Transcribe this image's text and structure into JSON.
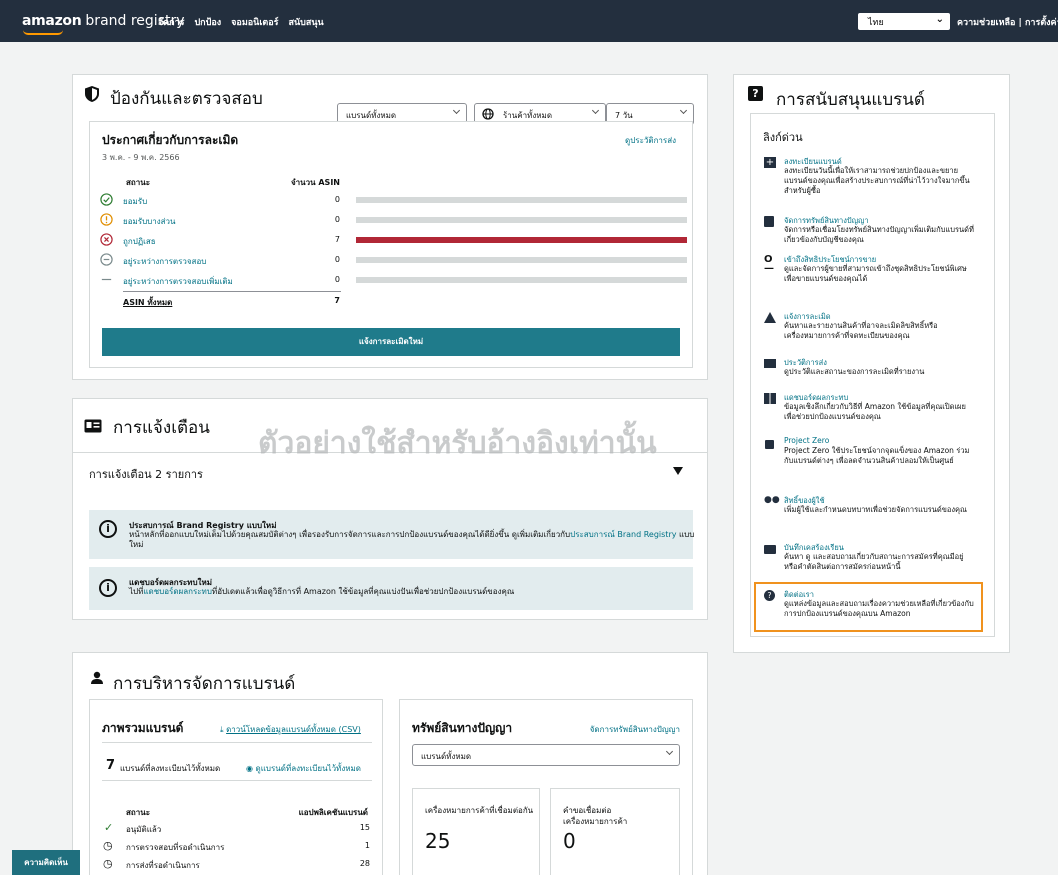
{
  "topbar": {
    "logo_brand": "amazon",
    "logo_product": "brand registry",
    "nav": [
      "จัดการ",
      "ปกป้อง",
      "จอมอนิเตอร์",
      "สนับสนุน"
    ],
    "language": "ไทย",
    "links": "ความช่วยเหลือ | การตั้งค่า"
  },
  "protect": {
    "title": "ป้องกันและตรวจสอบ",
    "filter_brand": "แบรนด์ทั้งหมด",
    "filter_store": "ร้านค้าทั้งหมด",
    "filter_days": "7 วัน",
    "report_title": "ประกาศเกี่ยวกับการละเมิด",
    "history_link": "ดูประวัติการส่ง",
    "date_range": "3 พ.ค. - 9 พ.ค. 2566",
    "col_status": "สถานะ",
    "col_count": "จำนวน ASIN",
    "rows": [
      {
        "label": "ยอมรับ",
        "count": "0",
        "fraction": 0
      },
      {
        "label": "ยอมรับบางส่วน",
        "count": "0",
        "fraction": 0
      },
      {
        "label": "ถูกปฏิเสธ",
        "count": "7",
        "fraction": 1
      },
      {
        "label": "อยู่ระหว่างการตรวจสอบ",
        "count": "0",
        "fraction": 0
      },
      {
        "label": "อยู่ระหว่างการตรวจสอบเพิ่มเติม",
        "count": "0",
        "fraction": 0
      }
    ],
    "total_label": "ASIN ทั้งหมด",
    "total_count": "7",
    "report_button": "แจ้งการละเมิดใหม่"
  },
  "alerts": {
    "title": "การแจ้งเตือน",
    "count_text": "การแจ้งเตือน 2 รายการ",
    "items": [
      {
        "title": "ประสบการณ์ Brand Registry แบบใหม่",
        "text": "หน้าหลักที่ออกแบบใหม่เต็มไปด้วยคุณสมบัติต่างๆ เพื่อรองรับการจัดการและการปกป้องแบรนด์ของคุณได้ดียิ่งขึ้น ดูเพิ่มเติมเกี่ยวกับ",
        "link": "ประสบการณ์ Brand Registry",
        "suffix": "แบบใหม่"
      },
      {
        "title": "แดชบอร์ดผลกระทบใหม่",
        "prefix": "ไปที่",
        "link": "แดชบอร์ดผลกระทบ",
        "text": "ที่อัปเดตแล้วเพื่อดูวิธีการที่ Amazon ใช้ข้อมูลที่คุณแบ่งปันเพื่อช่วยปกป้องแบรนด์ของคุณ"
      }
    ]
  },
  "manage": {
    "title": "การบริหารจัดการแบรนด์",
    "overview_title": "ภาพรวมแบรนด์",
    "download_link": "ดาวน์โหลดข้อมูลแบรนด์ทั้งหมด (CSV)",
    "registered_count": "7",
    "registered_text": "แบรนด์ที่ลงทะเบียนไว้ทั้งหมด",
    "view_link": "ดูแบรนด์ที่ลงทะเบียนไว้ทั้งหมด",
    "col_status": "สถานะ",
    "col_apps": "แอปพลิเคชันแบรนด์",
    "rows": [
      {
        "label": "อนุมัติแล้ว",
        "count": "15"
      },
      {
        "label": "การตรวจสอบที่รอดำเนินการ",
        "count": "1"
      },
      {
        "label": "การส่งที่รอดำเนินการ",
        "count": "28"
      }
    ],
    "ip_title": "ทรัพย์สินทางปัญญา",
    "ip_link": "จัดการทรัพย์สินทางปัญญา",
    "ip_filter": "แบรนด์ทั้งหมด",
    "tm_label": "เครื่องหมายการค้าที่เชื่อมต่อกัน",
    "tm_value": "25",
    "req_label": "คำขอเชื่อมต่อเครื่องหมายการค้า",
    "req_value": "0"
  },
  "support": {
    "title": "การสนับสนุนแบรนด์",
    "quick_links": "ลิงก์ด่วน",
    "items": [
      {
        "icon": "plus-square-icon",
        "title": "ลงทะเบียนแบรนด์",
        "desc": "ลงทะเบียนวันนี้เพื่อให้เราสามารถช่วยปกป้องและขยายแบรนด์ของคุณเพื่อสร้างประสบการณ์ที่น่าไว้วางใจมากขึ้นสำหรับผู้ซื้อ"
      },
      {
        "icon": "book-icon",
        "title": "จัดการทรัพย์สินทางปัญญา",
        "desc": "จัดการหรือเชื่อมโยงทรัพย์สินทางปัญญาเพิ่มเติมกับแบรนด์ที่เกี่ยวข้องกับบัญชีของคุณ"
      },
      {
        "icon": "key-icon",
        "title": "เข้าถึงสิทธิประโยชน์การขาย",
        "desc": "ดูและจัดการผู้ขายที่สามารถเข้าถึงชุดสิทธิประโยชน์พิเศษเพื่อขายแบรนด์ของคุณได้"
      },
      {
        "icon": "warning-icon",
        "title": "แจ้งการละเมิด",
        "desc": "ค้นหาและรายงานสินค้าที่อาจละเมิดลิขสิทธิ์หรือเครื่องหมายการค้าที่จดทะเบียนของคุณ"
      },
      {
        "icon": "folder-icon",
        "title": "ประวัติการส่ง",
        "desc": "ดูประวัติและสถานะของการละเมิดที่รายงาน"
      },
      {
        "icon": "dashboard-icon",
        "title": "แดชบอร์ดผลกระทบ",
        "desc": "ข้อมูลเชิงลึกเกี่ยวกับวิธีที่ Amazon ใช้ข้อมูลที่คุณเปิดเผยเพื่อช่วยปกป้องแบรนด์ของคุณ"
      },
      {
        "icon": "lock-icon",
        "title": "Project Zero",
        "desc": "Project Zero ใช้ประโยชน์จากจุดแข็งของ Amazon ร่วมกับแบรนด์ต่างๆ เพื่อลดจำนวนสินค้าปลอมให้เป็นศูนย์"
      },
      {
        "icon": "users-icon",
        "title": "สิทธิ์ของผู้ใช้",
        "desc": "เพิ่มผู้ใช้และกำหนดบทบาทเพื่อช่วยจัดการแบรนด์ของคุณ"
      },
      {
        "icon": "briefcase-icon",
        "title": "บันทึกเคสร้องเรียน",
        "desc": "ค้นหา ดู และสอบถามเกี่ยวกับสถานะการสมัครที่คุณมีอยู่หรือคำตัดสินต่อการสมัครก่อนหน้านี้"
      },
      {
        "icon": "help-icon",
        "title": "ติดต่อเรา",
        "desc": "ดูแหล่งข้อมูลและสอบถามเรื่องความช่วยเหลือที่เกี่ยวข้องกับการปกป้องแบรนด์ของคุณบน Amazon"
      }
    ]
  },
  "watermark": "ตัวอย่างใช้สำหรับอ้างอิงเท่านั้น",
  "feedback": "ความคิดเห็น",
  "colors": {
    "topbar": "#232f3e",
    "accent": "#1f7b8b",
    "rejected": "#b12736",
    "highlight": "#f0921e"
  }
}
